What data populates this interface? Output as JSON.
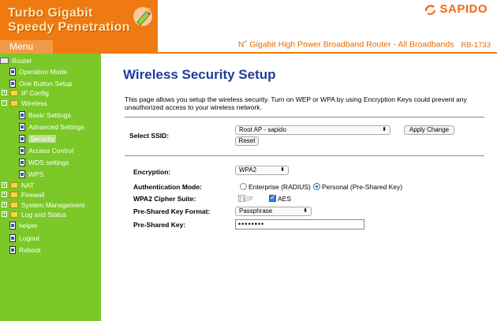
{
  "header": {
    "brand_line1": "Turbo Gigabit",
    "brand_line2": "Speedy Penetration",
    "menu_tab": "Menu",
    "logo": "SAPIDO",
    "banner_prefix": "N",
    "banner_sup": "+",
    "banner_text": "Gigabit High Power Broadband Router - All Broadbands",
    "model": "RB-1733",
    "accent_color": "#f07a12"
  },
  "sidebar": {
    "bg_color": "#7bc828",
    "items": [
      {
        "label": "Router",
        "icon": "router-icon"
      },
      {
        "label": "Operation Mode",
        "icon": "page-icon"
      },
      {
        "label": "One Button Setup",
        "icon": "page-icon"
      },
      {
        "label": "IP Config",
        "icon": "folder-icon"
      },
      {
        "label": "Wireless",
        "icon": "folder-icon"
      },
      {
        "label": "Basic Settings",
        "icon": "page-icon"
      },
      {
        "label": "Advanced Settings",
        "icon": "page-icon"
      },
      {
        "label": "Security",
        "icon": "page-icon"
      },
      {
        "label": "Access Control",
        "icon": "page-icon"
      },
      {
        "label": "WDS settings",
        "icon": "page-icon"
      },
      {
        "label": "WPS",
        "icon": "page-icon"
      },
      {
        "label": "NAT",
        "icon": "folder-icon"
      },
      {
        "label": "Firewall",
        "icon": "folder-icon"
      },
      {
        "label": "System Management",
        "icon": "folder-icon"
      },
      {
        "label": "Log and Status",
        "icon": "folder-icon"
      },
      {
        "label": "helper",
        "icon": "page-icon"
      },
      {
        "label": "Logout",
        "icon": "page-icon"
      },
      {
        "label": "Reboot",
        "icon": "page-icon"
      }
    ]
  },
  "main": {
    "title": "Wireless Security Setup",
    "description": "This page allows you setup the wireless security. Turn on WEP or WPA by using Encryption Keys could prevent any unauthorized access to your wireless network.",
    "ssid_label": "Select SSID:",
    "ssid_value": "Root AP - sapido",
    "apply_label": "Apply Change",
    "reset_label": "Reset",
    "encryption_label": "Encryption:",
    "encryption_value": "WPA2",
    "auth_label": "Authentication Mode:",
    "auth_opt1": "Enterprise (RADIUS)",
    "auth_opt2": "Personal (Pre-Shared Key)",
    "cipher_label": "WPA2 Cipher Suite:",
    "cipher_opt1": "TKIP",
    "cipher_opt2": "AES",
    "psk_format_label": "Pre-Shared Key Format:",
    "psk_format_value": "Passphrase",
    "psk_label": "Pre-Shared Key:",
    "psk_value": "••••••••",
    "title_color": "#1f3e9a"
  }
}
